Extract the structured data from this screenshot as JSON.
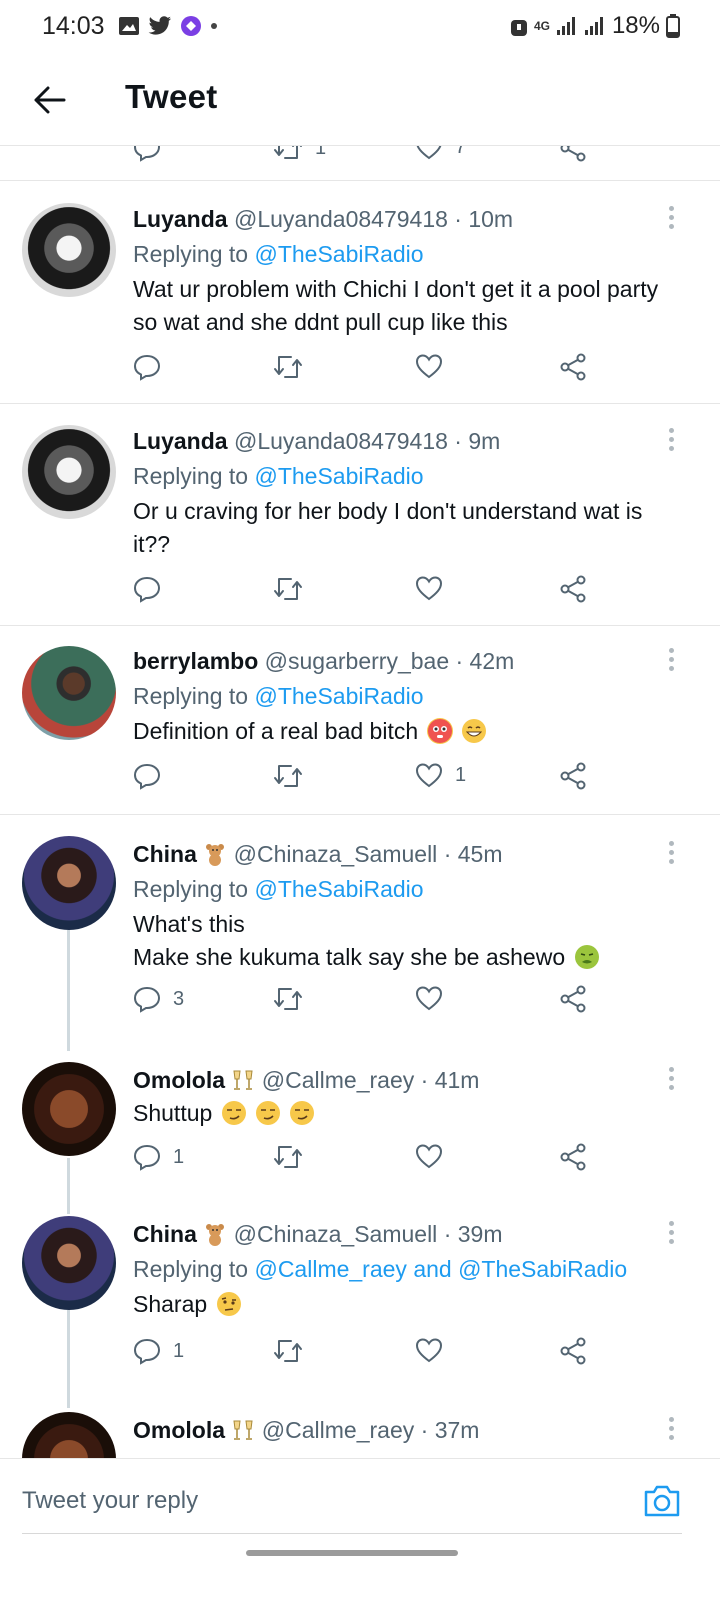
{
  "status_bar": {
    "time": "14:03",
    "network": "4G",
    "battery": "18%"
  },
  "header": {
    "title": "Tweet",
    "back_icon": "arrow-left-icon"
  },
  "partial_tweet": {
    "retweets": "1",
    "likes": "7"
  },
  "tweets": [
    {
      "name": "Luyanda",
      "handle": "@Luyanda08479418",
      "time": "· 10m",
      "replying_label": "Replying to",
      "replying_to": "@TheSabiRadio",
      "text": "Wat ur problem with Chichi I don't get it a pool party so wat and she ddnt pull cup like this",
      "replies": "",
      "retweets": "",
      "likes": ""
    },
    {
      "name": "Luyanda",
      "handle": "@Luyanda08479418",
      "time": "· 9m",
      "replying_label": "Replying to",
      "replying_to": "@TheSabiRadio",
      "text": "Or u craving for her body I don't understand wat is it??",
      "replies": "",
      "retweets": "",
      "likes": ""
    },
    {
      "name": "berrylambo",
      "handle": "@sugarberry_bae",
      "time": "· 42m",
      "replying_label": "Replying to",
      "replying_to": "@TheSabiRadio",
      "text": "Definition of a real bad bitch",
      "replies": "",
      "retweets": "",
      "likes": "1"
    },
    {
      "name": "China",
      "handle": "@Chinaza_Samuell",
      "time": "· 45m",
      "replying_label": "Replying to",
      "replying_to": "@TheSabiRadio",
      "text_line1": "What's this",
      "text_line2": "Make she kukuma talk say she be ashewo",
      "replies": "3",
      "retweets": "",
      "likes": ""
    },
    {
      "name": "Omolola",
      "handle": "@Callme_raey",
      "time": "· 41m",
      "text": "Shuttup",
      "replies": "1",
      "retweets": "",
      "likes": ""
    },
    {
      "name": "China",
      "handle": "@Chinaza_Samuell",
      "time": "· 39m",
      "replying_label": "Replying to",
      "replying_to": "@Callme_raey and @TheSabiRadio",
      "text": "Sharap",
      "replies": "1",
      "retweets": "",
      "likes": ""
    },
    {
      "name": "Omolola",
      "handle": "@Callme_raey",
      "time": "· 37m"
    }
  ],
  "reply_bar": {
    "placeholder": "Tweet your reply"
  },
  "colors": {
    "link": "#1d9bf0",
    "secondary_text": "#536471",
    "divider": "#e6e6e6"
  }
}
